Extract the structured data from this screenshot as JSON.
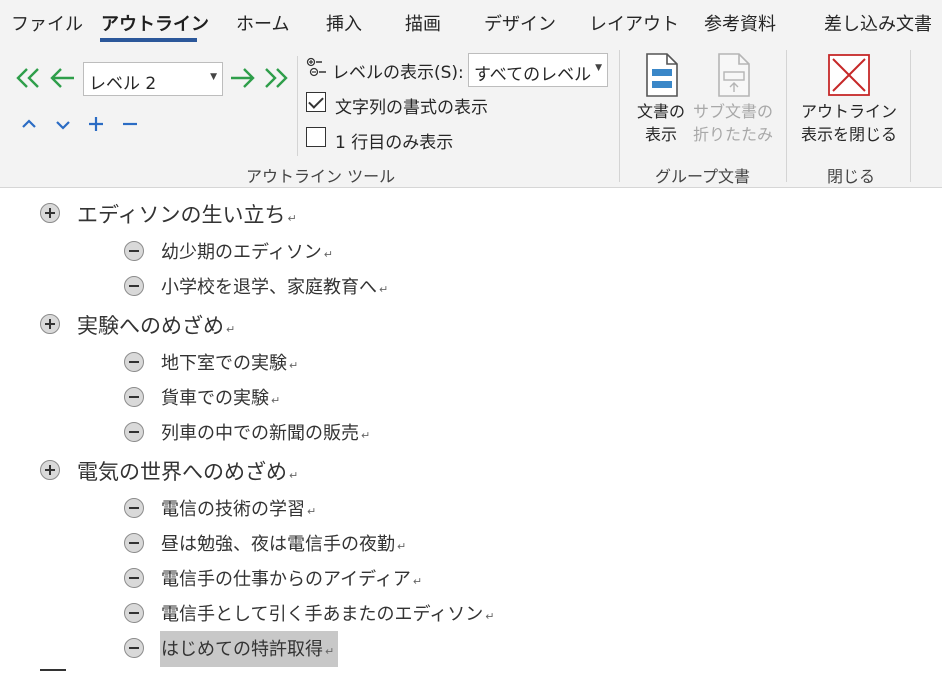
{
  "tabs": [
    {
      "label": "ファイル"
    },
    {
      "label": "アウトライン"
    },
    {
      "label": "ホーム"
    },
    {
      "label": "挿入"
    },
    {
      "label": "描画"
    },
    {
      "label": "デザイン"
    },
    {
      "label": "レイアウト"
    },
    {
      "label": "参考資料"
    },
    {
      "label": "差し込み文書"
    }
  ],
  "active_tab": "アウトライン",
  "ribbon": {
    "outline_tools": {
      "group_label": "アウトライン ツール",
      "level_dropdown_value": "レベル 2",
      "show_level_label": "レベルの表示(S):",
      "show_level_value": "すべてのレベル",
      "show_formatting_label": "文字列の書式の表示",
      "show_formatting_checked": true,
      "first_line_only_label": "1 行目のみ表示",
      "first_line_only_checked": false,
      "buttons": {
        "promote_to_heading1": "≪",
        "promote": "←",
        "demote": "→",
        "demote_to_body": "≫",
        "move_up": "⌃",
        "move_down": "⌄",
        "expand": "+",
        "collapse": "−"
      }
    },
    "master_document": {
      "group_label": "グループ文書",
      "show_document_line1": "文書の",
      "show_document_line2": "表示",
      "collapse_subdocs_line1": "サブ文書の",
      "collapse_subdocs_line2": "折りたたみ"
    },
    "close": {
      "group_label": "閉じる",
      "close_outline_line1": "アウトライン",
      "close_outline_line2": "表示を閉じる"
    }
  },
  "accent_color": "#2b579a",
  "arrow_color": "#2e9e4a",
  "outline": {
    "paragraph_mark": "↵",
    "items": [
      {
        "text": "エディソンの生い立ち",
        "level": 1,
        "symbol": "plus"
      },
      {
        "text": "幼少期のエディソン",
        "level": 2,
        "symbol": "minus"
      },
      {
        "text": "小学校を退学、家庭教育へ",
        "level": 2,
        "symbol": "minus"
      },
      {
        "text": "実験へのめざめ",
        "level": 1,
        "symbol": "plus"
      },
      {
        "text": "地下室での実験",
        "level": 2,
        "symbol": "minus"
      },
      {
        "text": "貨車での実験",
        "level": 2,
        "symbol": "minus"
      },
      {
        "text": "列車の中での新聞の販売",
        "level": 2,
        "symbol": "minus"
      },
      {
        "text": "電気の世界へのめざめ",
        "level": 1,
        "symbol": "plus"
      },
      {
        "text": "電信の技術の学習",
        "level": 2,
        "symbol": "minus"
      },
      {
        "text": "昼は勉強、夜は電信手の夜勤",
        "level": 2,
        "symbol": "minus"
      },
      {
        "text": "電信手の仕事からのアイディア",
        "level": 2,
        "symbol": "minus"
      },
      {
        "text": "電信手として引く手あまたのエディソン",
        "level": 2,
        "symbol": "minus"
      },
      {
        "text": "はじめての特許取得",
        "level": 2,
        "symbol": "minus",
        "selected": true
      }
    ]
  }
}
